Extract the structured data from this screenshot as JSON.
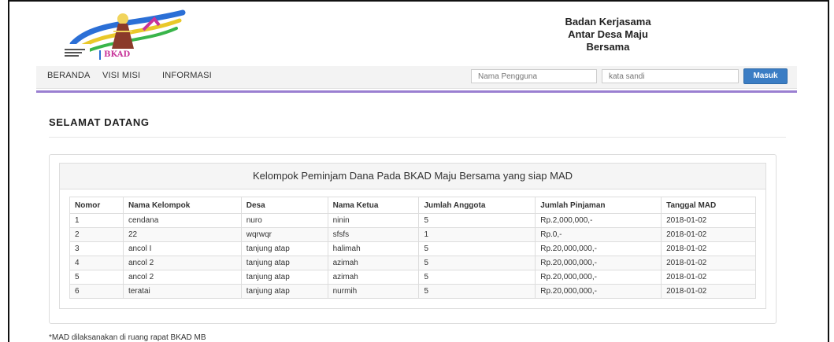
{
  "header": {
    "logo_alt": "BKAD",
    "logo_text": "BKAD",
    "title_lines": [
      "Badan Kerjasama",
      "Antar Desa Maju",
      "Bersama"
    ]
  },
  "nav": {
    "items": [
      "BERANDA",
      "VISI MISI",
      "INFORMASI"
    ],
    "username_placeholder": "Nama Pengguna",
    "password_placeholder": "kata sandi",
    "login_label": "Masuk"
  },
  "main": {
    "welcome": "SELAMAT DATANG",
    "panel_title": "Kelompok Peminjam Dana Pada BKAD Maju Bersama yang siap MAD",
    "table": {
      "headers": [
        "Nomor",
        "Nama Kelompok",
        "Desa",
        "Nama Ketua",
        "Jumlah Anggota",
        "Jumlah Pinjaman",
        "Tanggal MAD"
      ],
      "rows": [
        [
          "1",
          "cendana",
          "nuro",
          "ninin",
          "5",
          "Rp.2,000,000,-",
          "2018-01-02"
        ],
        [
          "2",
          "22",
          "wqrwqr",
          "sfsfs",
          "1",
          "Rp.0,-",
          "2018-01-02"
        ],
        [
          "3",
          "ancol I",
          "tanjung atap",
          "halimah",
          "5",
          "Rp.20,000,000,-",
          "2018-01-02"
        ],
        [
          "4",
          "ancol 2",
          "tanjung atap",
          "azimah",
          "5",
          "Rp.20,000,000,-",
          "2018-01-02"
        ],
        [
          "5",
          "ancol 2",
          "tanjung atap",
          "azimah",
          "5",
          "Rp.20,000,000,-",
          "2018-01-02"
        ],
        [
          "6",
          "teratai",
          "tanjung atap",
          "nurmih",
          "5",
          "Rp.20,000,000,-",
          "2018-01-02"
        ]
      ]
    },
    "footnote": "*MAD dilaksanakan di ruang rapat BKAD MB"
  },
  "colors": {
    "accent_purple": "#9a7fd1",
    "button_blue": "#3b7dc4"
  }
}
